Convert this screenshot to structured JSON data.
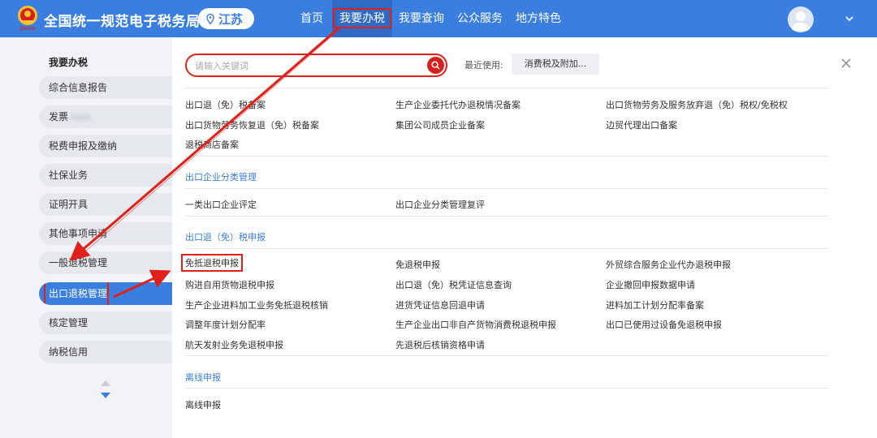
{
  "header": {
    "site_title": "全国统一规范电子税务局",
    "region": "江苏",
    "nav": [
      "首页",
      "我要办税",
      "我要查询",
      "公众服务",
      "地方特色"
    ],
    "emblem_text": "国家税务"
  },
  "sidebar": {
    "title": "我要办税",
    "items": [
      "综合信息报告",
      "发票",
      "税费申报及缴纳",
      "社保业务",
      "证明开具",
      "其他事项申请",
      "一般退税管理",
      "出口退税管理",
      "核定管理",
      "纳税信用"
    ]
  },
  "search": {
    "placeholder": "请输入关键词",
    "recent_label": "最近使用:",
    "recent_item": "消费税及附加..."
  },
  "groups": {
    "top_links": [
      "出口退（免）税备案",
      "生产企业委托代办退税情况备案",
      "出口货物劳务及服务放弃退（免）税权/免税权",
      "出口货物劳务恢复退（免）税备案",
      "集团公司成员企业备案",
      "边贸代理出口备案",
      "退税商店备案"
    ],
    "classify_title": "出口企业分类管理",
    "classify_links": [
      "一类出口企业评定",
      "出口企业分类管理复评"
    ],
    "declare_title": "出口退（免）税申报",
    "declare_links": [
      "免抵退税申报",
      "免退税申报",
      "外贸综合服务企业代办退税申报",
      "购进自用货物退税申报",
      "出口退（免）税凭证信息查询",
      "企业撤回申报数据申请",
      "生产企业进料加工业务免抵退税核销",
      "进货凭证信息回退申请",
      "进料加工计划分配率备案",
      "调整年度计划分配率",
      "生产企业出口非自产货物消费税退税申报",
      "出口已使用过设备免退税申报",
      "航天发射业务免退税申报",
      "先退税后核销资格申请"
    ],
    "offline_title": "离线申报",
    "offline_links": [
      "离线申报"
    ]
  },
  "colors": {
    "brand": "#3a7fe0",
    "highlight": "#e0201a",
    "active_nav": "#2f6bc4"
  },
  "icons": {
    "location": "location-pin-icon",
    "search": "search-icon",
    "close": "close-icon",
    "user": "user-avatar-icon",
    "chevron": "chevron-down-icon",
    "scroll": "scroll-arrows-icon"
  }
}
